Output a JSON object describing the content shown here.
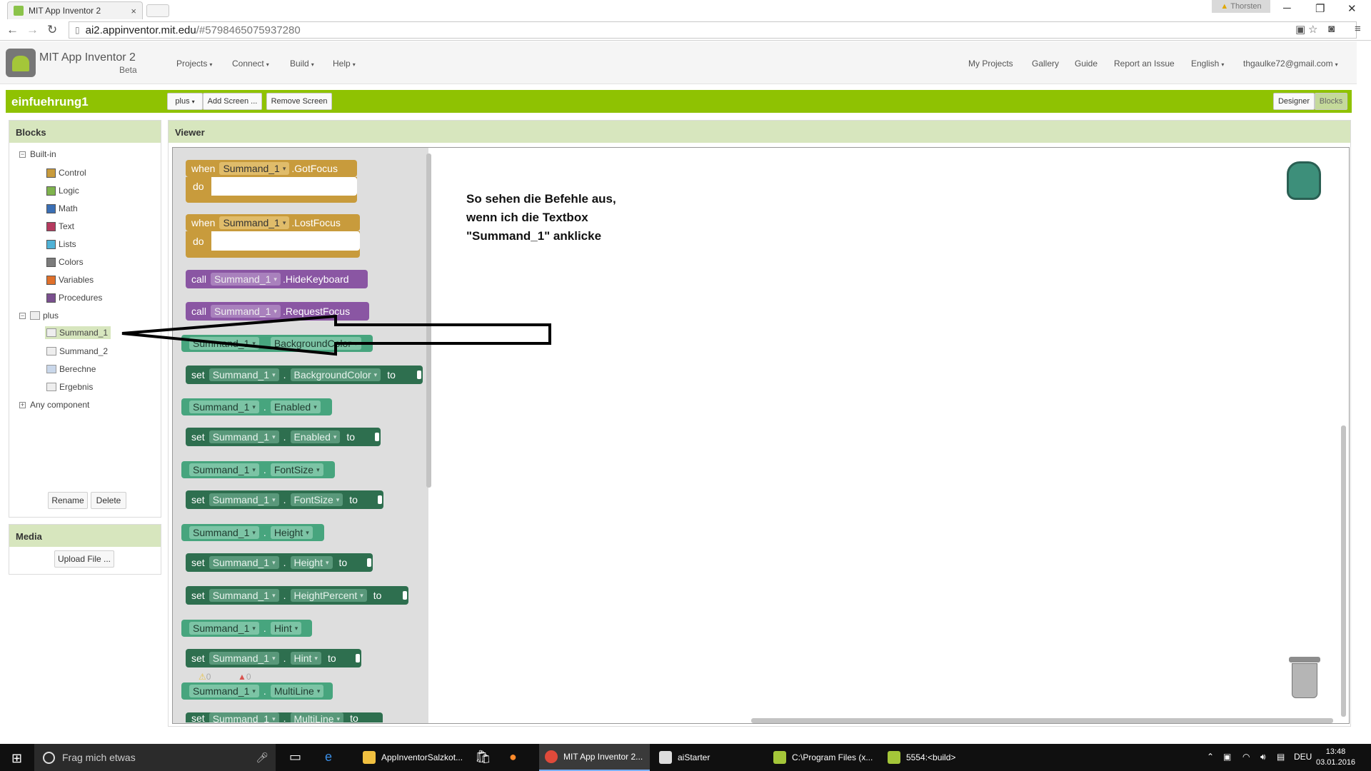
{
  "browser": {
    "tab_title": "MIT App Inventor 2",
    "tab_close": "×",
    "user": "Thorsten",
    "url_host": "ai2.appinventor.mit.edu",
    "url_path": "/#5798465075937280"
  },
  "app": {
    "title": "MIT App Inventor 2",
    "beta": "Beta",
    "menu": [
      "Projects",
      "Connect",
      "Build",
      "Help"
    ],
    "right_menu": {
      "my_projects": "My Projects",
      "gallery": "Gallery",
      "guide": "Guide",
      "report": "Report an Issue",
      "language": "English",
      "account": "thgaulke72@gmail.com"
    }
  },
  "toolbar": {
    "project": "einfuehrung1",
    "screen": "plus",
    "add_screen": "Add Screen ...",
    "remove_screen": "Remove Screen",
    "designer": "Designer",
    "blocks": "Blocks"
  },
  "blocks_panel": {
    "title": "Blocks",
    "builtin": "Built-in",
    "builtin_items": [
      {
        "label": "Control",
        "color": "#c89b3c"
      },
      {
        "label": "Logic",
        "color": "#7fb34d"
      },
      {
        "label": "Math",
        "color": "#3a6fb5"
      },
      {
        "label": "Text",
        "color": "#b53a5f"
      },
      {
        "label": "Lists",
        "color": "#4fb2d6"
      },
      {
        "label": "Colors",
        "color": "#7b7b7b"
      },
      {
        "label": "Variables",
        "color": "#e0702b"
      },
      {
        "label": "Procedures",
        "color": "#7a4f8f"
      }
    ],
    "screen": "plus",
    "components": [
      "Summand_1",
      "Summand_2",
      "Berechne",
      "Ergebnis"
    ],
    "any_component": "Any component",
    "rename": "Rename",
    "delete": "Delete"
  },
  "media": {
    "title": "Media",
    "upload": "Upload File ..."
  },
  "viewer": {
    "title": "Viewer",
    "note": "So sehen die Befehle aus, wenn ich die Textbox \"Summand_1\" anklicke",
    "warnings": "0",
    "errors": "0"
  },
  "kw": {
    "when": "when",
    "do": "do",
    "call": "call",
    "set": "set",
    "to": "to",
    "dot": "."
  },
  "blocks": {
    "comp": "Summand_1",
    "gotfocus": ".GotFocus",
    "lostfocus": ".LostFocus",
    "hidekeyboard": ".HideKeyboard",
    "requestfocus": ".RequestFocus",
    "bgcolor": "BackgroundColor",
    "enabled": "Enabled",
    "fontsize": "FontSize",
    "height": "Height",
    "heightpercent": "HeightPercent",
    "hint": "Hint",
    "multiline": "MultiLine"
  },
  "taskbar": {
    "search": "Frag mich etwas",
    "tasks": [
      "AppInventorSalzkot...",
      "MIT App Inventor 2...",
      "aiStarter",
      "C:\\Program Files (x...",
      "5554:<build>"
    ],
    "lang": "DEU",
    "time": "13:48",
    "date": "03.01.2016"
  }
}
